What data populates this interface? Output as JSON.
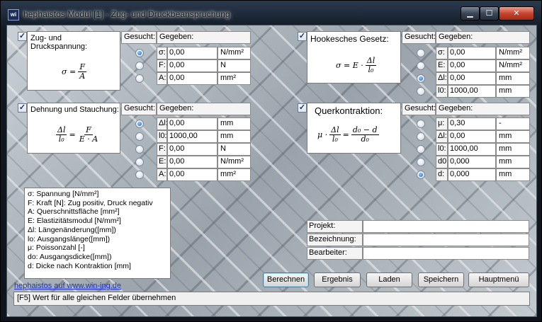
{
  "window": {
    "icon_text": "wi",
    "title": "hephaistos Modul [1] - Zug- und Druckbeanspruchung",
    "min": "▁",
    "max": "☐",
    "close": "✕"
  },
  "common": {
    "gesucht": "Gesucht:",
    "gegeben": "Gegeben:",
    "check": "✓"
  },
  "panels": {
    "zug": {
      "title": "Zug- und Druckspannung:",
      "checked": true,
      "formula": {
        "lhs": "σ =",
        "num": "F",
        "den": "A"
      },
      "selected": 0,
      "rows": [
        {
          "label": "σ:",
          "value": "0,00",
          "unit": "N/mm²"
        },
        {
          "label": "F:",
          "value": "0,00",
          "unit": "N"
        },
        {
          "label": "A:",
          "value": "0,00",
          "unit": "mm²"
        }
      ]
    },
    "hooke": {
      "title": "Hookesches Gesetz:",
      "checked": true,
      "formula": {
        "lhs": "σ = E ·",
        "num": "Δl",
        "den": "l₀"
      },
      "selected": 2,
      "rows": [
        {
          "label": "σ:",
          "value": "0,00",
          "unit": "N/mm²"
        },
        {
          "label": "E:",
          "value": "0,00",
          "unit": "N/mm²"
        },
        {
          "label": "Δl:",
          "value": "0,00",
          "unit": "mm"
        },
        {
          "label": "l0:",
          "value": "1000,00",
          "unit": "mm"
        }
      ]
    },
    "dehnung": {
      "title": "Dehnung und Stauchung:",
      "checked": true,
      "formula": {
        "num1": "Δl",
        "den1": "l₀",
        "eq": "=",
        "num2": "F",
        "den2": "E · A"
      },
      "selected": 0,
      "rows": [
        {
          "label": "Δl:",
          "value": "0,00",
          "unit": "mm"
        },
        {
          "label": "l0:",
          "value": "1000,00",
          "unit": "mm"
        },
        {
          "label": "F:",
          "value": "0,00",
          "unit": "N"
        },
        {
          "label": "E:",
          "value": "0,00",
          "unit": "N/mm²"
        },
        {
          "label": "A:",
          "value": "0,00",
          "unit": "mm²"
        }
      ]
    },
    "quer": {
      "title": "Querkontraktion:",
      "checked": true,
      "formula": {
        "lhs": "μ ·",
        "num1": "Δl",
        "den1": "l₀",
        "eq": "=",
        "num2": "d₀ − d",
        "den2": "d₀"
      },
      "selected": 4,
      "rows": [
        {
          "label": "μ:",
          "value": "0,30",
          "unit": "-"
        },
        {
          "label": "Δl:",
          "value": "0,00",
          "unit": "mm"
        },
        {
          "label": "l0:",
          "value": "1000,00",
          "unit": "mm"
        },
        {
          "label": "d0",
          "value": "0,000",
          "unit": "mm"
        },
        {
          "label": "d:",
          "value": "0,000",
          "unit": "mm"
        }
      ]
    }
  },
  "legend": [
    "σ: Spannung [N/mm²]",
    "F: Kraft [N]: Zug positiv, Druck negativ",
    "A: Querschnittsfläche [mm²]",
    "E: Elastizitätsmodul [N/mm²]",
    "Δl: Längenänderung([mm])",
    "lo: Ausgangslänge([mm])",
    "μ: Poissonzahl [-]",
    "do: Ausgangsdicke([mm])",
    "d: Dicke nach Kontraktion [mm]"
  ],
  "project": {
    "fields": [
      {
        "label": "Projekt:",
        "value": ""
      },
      {
        "label": "Bezeichnung:",
        "value": ""
      },
      {
        "label": "Bearbeiter:",
        "value": ""
      }
    ]
  },
  "buttons": {
    "berechnen": "Berechnen",
    "ergebnis": "Ergebnis",
    "laden": "Laden",
    "speichern": "Speichern",
    "hauptmenue": "Hauptmenü"
  },
  "link": "hephaistos auf www.win-ing.de",
  "status": "[F5] Wert für alle gleichen Felder übernehmen"
}
